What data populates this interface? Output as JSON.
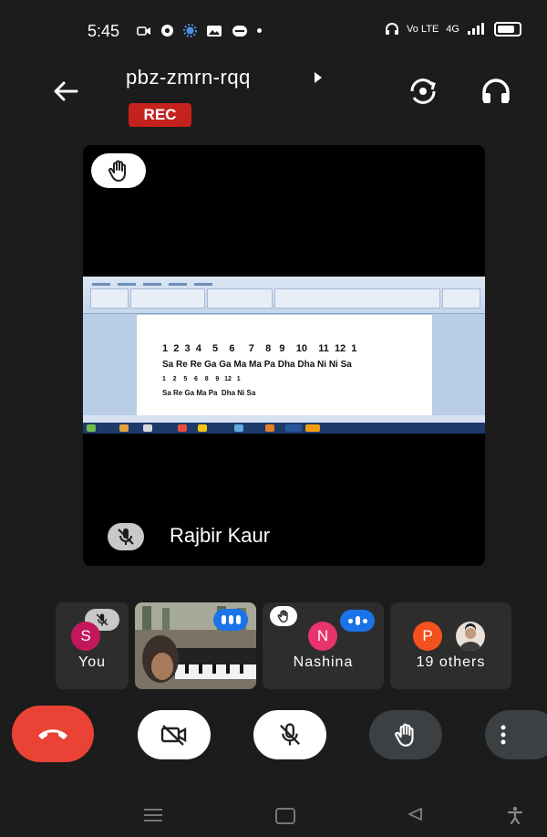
{
  "status_bar": {
    "time": "5:45",
    "network_label": "Vo LTE",
    "signal_label": "4G"
  },
  "meeting": {
    "code": "pbz-zmrn-rqq",
    "recording_badge": "REC"
  },
  "main_tile": {
    "presenter_name": "Rajbir Kaur",
    "shared_document": {
      "line1": "1  2  3  4    5    6     7    8   9    10    11  12  1",
      "line2": "Sa Re Re Ga Ga Ma Ma Pa Dha Dha Ni Ni Sa",
      "line3": "1    2    5    6    8    9   12   1",
      "line4": "Sa Re Ga Ma Pa  Dha Ni Sa"
    }
  },
  "participants": [
    {
      "label": "You",
      "initial": "S",
      "avatar_color": "#c2185b"
    },
    {
      "label": "",
      "initial": "",
      "avatar_color": ""
    },
    {
      "label": "Nashina",
      "initial": "N",
      "avatar_color": "#e8336d"
    },
    {
      "label": "19 others",
      "initial": "P",
      "avatar_color": "#f4511e"
    }
  ],
  "colors": {
    "end_call": "#ea4335",
    "rec_badge": "#c5221f",
    "speaking_indicator": "#1a73e8"
  }
}
